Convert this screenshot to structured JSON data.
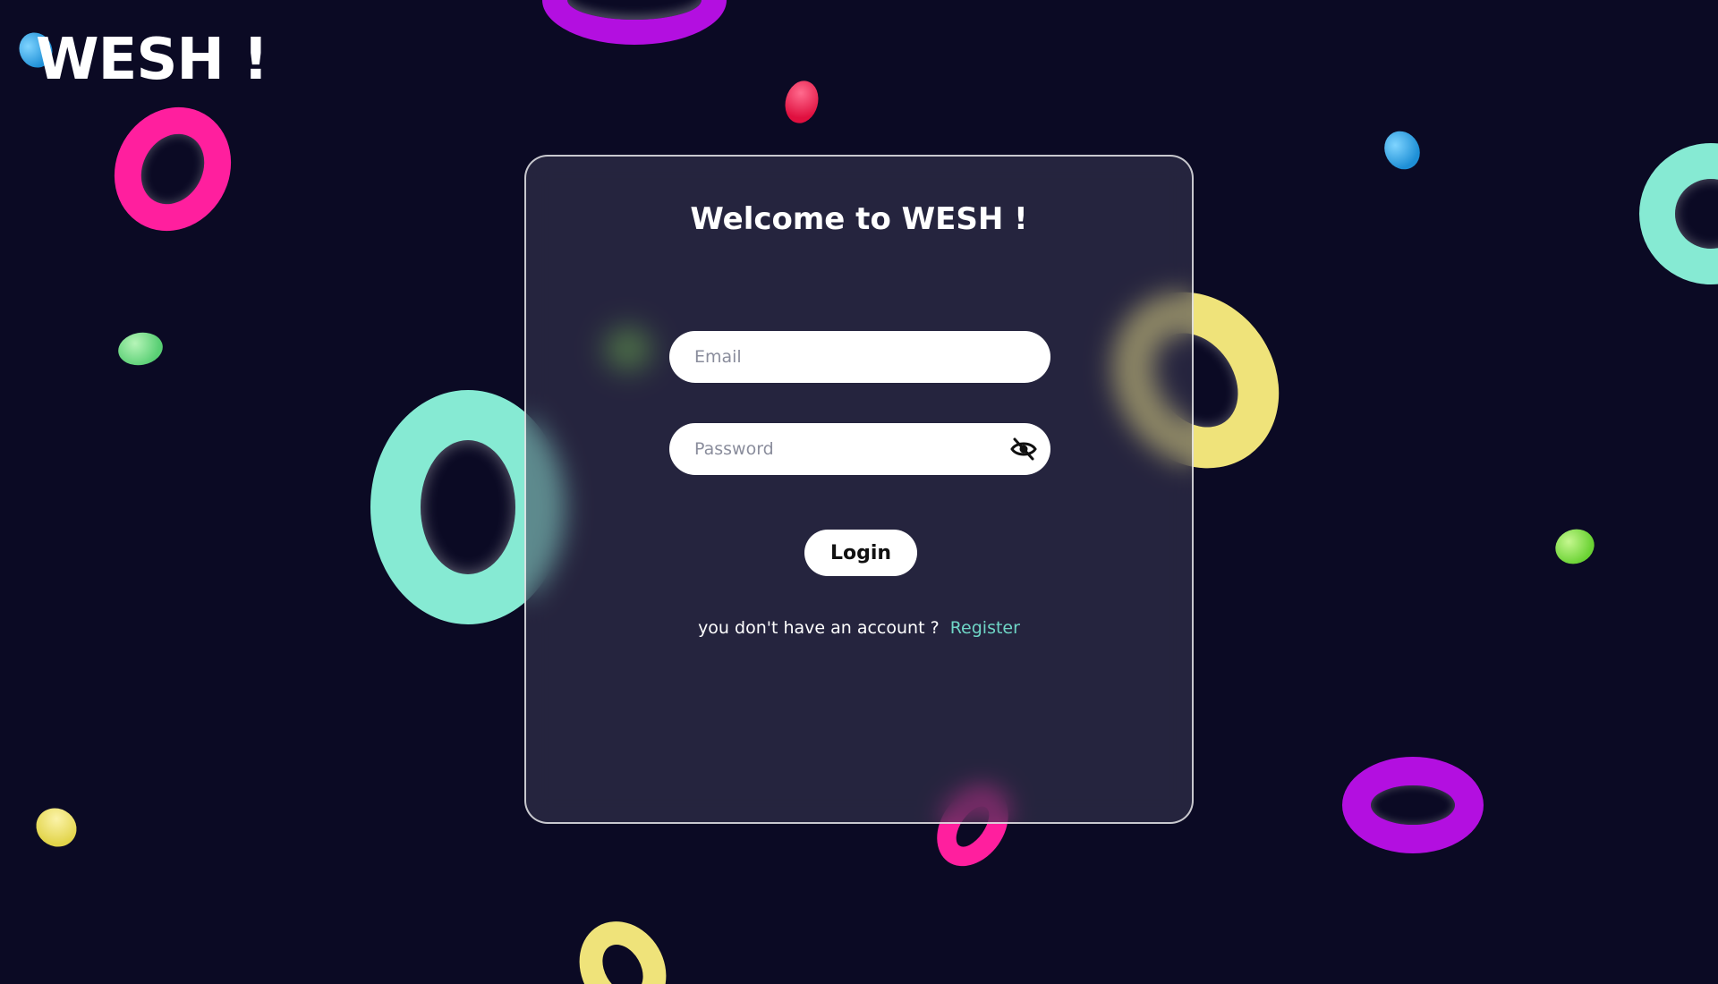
{
  "app": {
    "logo_text": "WESH !"
  },
  "login_card": {
    "title": "Welcome to WESH !",
    "email_placeholder": "Email",
    "password_placeholder": "Password",
    "login_label": "Login",
    "register_prompt": "you don't have an account ?",
    "register_link": "Register",
    "password_toggle_icon": "eye-slash-icon"
  },
  "colors": {
    "background": "#0b0a24",
    "accent_link": "#6fd6c6",
    "card_border": "#ffffff",
    "donut_pink": "#ff1f9e",
    "donut_purple": "#b30fe0",
    "donut_teal": "#86ead3",
    "donut_yellow": "#efe37a",
    "pill_red": "#ff1f5a",
    "pill_blue": "#2aa5e8",
    "pill_green": "#76e07c",
    "pill_lime": "#7ee34a",
    "pill_yellow": "#f0e46a"
  }
}
